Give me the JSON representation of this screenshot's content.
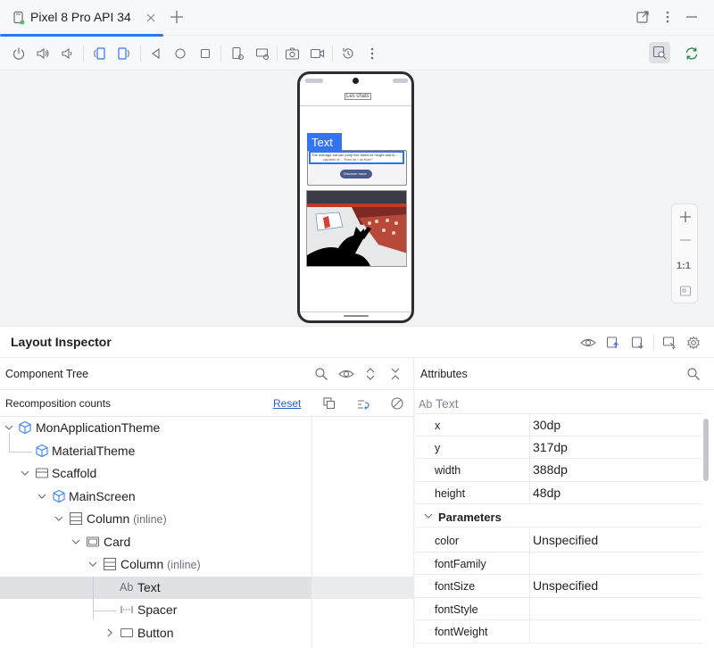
{
  "tab": {
    "title": "Pixel 8 Pro API 34"
  },
  "icons": [
    "device-icon",
    "close-icon",
    "add-tab-icon",
    "external-window-icon",
    "more-vert-icon",
    "minimize-icon"
  ],
  "phone": {
    "top_label": "Les chats",
    "text_overlay": "Text",
    "card_text": "The average cat can jump five times its height and is...",
    "card_text_2": "capable of... 'How do I do that?'",
    "button_label": "Discover more"
  },
  "zoom": {
    "ratio_label": "1:1"
  },
  "inspector": {
    "title": "Layout Inspector"
  },
  "component_tree": {
    "title": "Component Tree",
    "recomposition_label": "Recomposition counts",
    "reset_label": "Reset",
    "nodes": [
      {
        "name": "MonApplicationTheme",
        "suffix": ""
      },
      {
        "name": "MaterialTheme",
        "suffix": ""
      },
      {
        "name": "Scaffold",
        "suffix": ""
      },
      {
        "name": "MainScreen",
        "suffix": ""
      },
      {
        "name": "Column",
        "suffix": "(inline)"
      },
      {
        "name": "Card",
        "suffix": ""
      },
      {
        "name": "Column",
        "suffix": "(inline)"
      },
      {
        "name": "Text",
        "suffix": "",
        "prefix": "Ab"
      },
      {
        "name": "Spacer",
        "suffix": ""
      },
      {
        "name": "Button",
        "suffix": ""
      }
    ]
  },
  "attributes": {
    "title": "Attributes",
    "selected_prefix": "Ab",
    "selected": "Text",
    "rows": [
      {
        "key": "x",
        "value": "30dp"
      },
      {
        "key": "y",
        "value": "317dp"
      },
      {
        "key": "width",
        "value": "388dp"
      },
      {
        "key": "height",
        "value": "48dp"
      }
    ],
    "params_label": "Parameters",
    "params": [
      {
        "key": "color",
        "value": "Unspecified"
      },
      {
        "key": "fontFamily",
        "value": ""
      },
      {
        "key": "fontSize",
        "value": "Unspecified"
      },
      {
        "key": "fontStyle",
        "value": ""
      },
      {
        "key": "fontWeight",
        "value": ""
      }
    ]
  },
  "colors": {
    "accent": "#3574f0",
    "selection": "#dfe1e5",
    "compose_icon": "#3b82f6",
    "sync": "#208a3c"
  }
}
